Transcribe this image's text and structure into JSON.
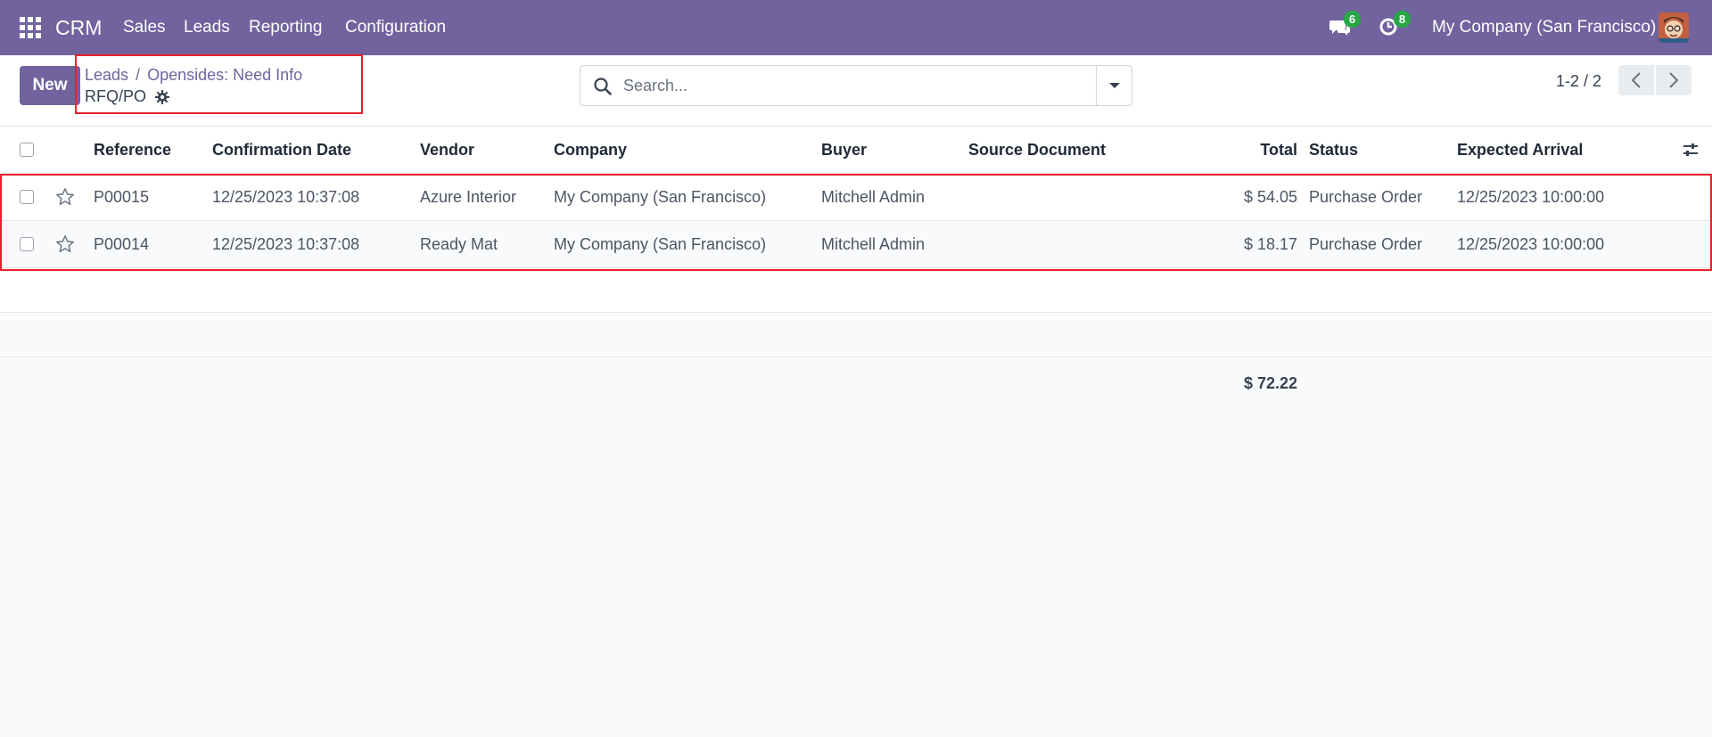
{
  "navbar": {
    "app_name": "CRM",
    "menu": [
      "Sales",
      "Leads",
      "Reporting",
      "Configuration"
    ],
    "messages_count": "6",
    "activities_count": "8",
    "company": "My Company (San Francisco)",
    "bg_color": "#71639e"
  },
  "control_panel": {
    "new_label": "New",
    "breadcrumb": [
      "Leads",
      "Opensides: Need Info"
    ],
    "breadcrumb_sep": "/",
    "subtitle": "RFQ/PO",
    "search_placeholder": "Search...",
    "pager": "1-2 / 2"
  },
  "table": {
    "headers": [
      "Reference",
      "Confirmation Date",
      "Vendor",
      "Company",
      "Buyer",
      "Source Document",
      "Total",
      "Status",
      "Expected Arrival"
    ],
    "rows": [
      {
        "reference": "P00015",
        "confirmation_date": "12/25/2023 10:37:08",
        "vendor": "Azure Interior",
        "company": "My Company (San Francisco)",
        "buyer": "Mitchell Admin",
        "source_document": "",
        "total": "$ 54.05",
        "status": "Purchase Order",
        "expected_arrival": "12/25/2023 10:00:00"
      },
      {
        "reference": "P00014",
        "confirmation_date": "12/25/2023 10:37:08",
        "vendor": "Ready Mat",
        "company": "My Company (San Francisco)",
        "buyer": "Mitchell Admin",
        "source_document": "",
        "total": "$ 18.17",
        "status": "Purchase Order",
        "expected_arrival": "12/25/2023 10:00:00"
      }
    ],
    "sum_total": "$ 72.22"
  },
  "icons": [
    "apps-grid-icon",
    "chat-icon",
    "clock-icon",
    "gear-icon",
    "search-icon",
    "caret-down-icon",
    "chevron-left-icon",
    "chevron-right-icon",
    "star-icon",
    "optional-columns-icon"
  ],
  "highlight_color": "#e8212c"
}
